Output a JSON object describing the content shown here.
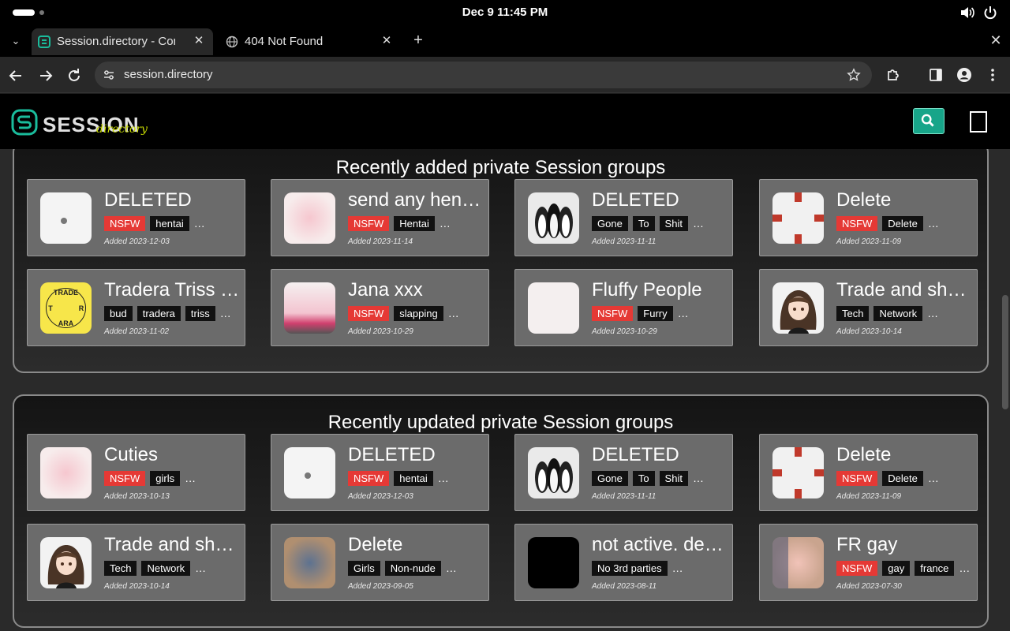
{
  "os": {
    "clock": "Dec 9  11:45 PM"
  },
  "browser": {
    "tabs": [
      {
        "title": "Session.directory - Conn",
        "favicon": "session-favicon"
      },
      {
        "title": "404 Not Found",
        "favicon": "globe-icon"
      }
    ],
    "url": "session.directory"
  },
  "site": {
    "logo_text": "SESSION",
    "logo_sub": "directory",
    "accent": "#17a589"
  },
  "sections": [
    {
      "heading": "Recently added private Session groups",
      "cards": [
        {
          "title": "DELETED",
          "tags": [
            {
              "label": "NSFW",
              "nsfw": true
            },
            {
              "label": "hentai"
            }
          ],
          "added": "Added 2023-12-03",
          "thumb": "white-dot"
        },
        {
          "title": "send any hen…",
          "tags": [
            {
              "label": "NSFW",
              "nsfw": true
            },
            {
              "label": "Hentai"
            }
          ],
          "added": "Added 2023-11-14",
          "thumb": "pink-blur"
        },
        {
          "title": "DELETED",
          "tags": [
            {
              "label": "Gone"
            },
            {
              "label": "To"
            },
            {
              "label": "Shit"
            }
          ],
          "added": "Added 2023-11-11",
          "thumb": "penguins"
        },
        {
          "title": "Delete",
          "tags": [
            {
              "label": "NSFW",
              "nsfw": true
            },
            {
              "label": "Delete"
            }
          ],
          "added": "Added 2023-11-09",
          "thumb": "red-cross"
        },
        {
          "title": "Tradera Triss …",
          "tags": [
            {
              "label": "bud"
            },
            {
              "label": "tradera"
            },
            {
              "label": "triss"
            }
          ],
          "added": "Added 2023-11-02",
          "thumb": "tradera-logo"
        },
        {
          "title": "Jana xxx",
          "tags": [
            {
              "label": "NSFW",
              "nsfw": true
            },
            {
              "label": "slapping"
            }
          ],
          "added": "Added 2023-10-29",
          "thumb": "pink-band"
        },
        {
          "title": "Fluffy People",
          "tags": [
            {
              "label": "NSFW",
              "nsfw": true
            },
            {
              "label": "Furry"
            }
          ],
          "added": "Added 2023-10-29",
          "thumb": "white-blank"
        },
        {
          "title": "Trade and sh…",
          "tags": [
            {
              "label": "Tech"
            },
            {
              "label": "Network"
            }
          ],
          "added": "Added 2023-10-14",
          "thumb": "anime-girl"
        }
      ]
    },
    {
      "heading": "Recently updated private Session groups",
      "cards": [
        {
          "title": "Cuties",
          "tags": [
            {
              "label": "NSFW",
              "nsfw": true
            },
            {
              "label": "girls"
            }
          ],
          "added": "Added 2023-10-13",
          "thumb": "pink-blur"
        },
        {
          "title": "DELETED",
          "tags": [
            {
              "label": "NSFW",
              "nsfw": true
            },
            {
              "label": "hentai"
            }
          ],
          "added": "Added 2023-12-03",
          "thumb": "white-dot"
        },
        {
          "title": "DELETED",
          "tags": [
            {
              "label": "Gone"
            },
            {
              "label": "To"
            },
            {
              "label": "Shit"
            }
          ],
          "added": "Added 2023-11-11",
          "thumb": "penguins"
        },
        {
          "title": "Delete",
          "tags": [
            {
              "label": "NSFW",
              "nsfw": true
            },
            {
              "label": "Delete"
            }
          ],
          "added": "Added 2023-11-09",
          "thumb": "red-cross"
        },
        {
          "title": "Trade and sh…",
          "tags": [
            {
              "label": "Tech"
            },
            {
              "label": "Network"
            }
          ],
          "added": "Added 2023-10-14",
          "thumb": "anime-girl"
        },
        {
          "title": "Delete",
          "tags": [
            {
              "label": "Girls"
            },
            {
              "label": "Non-nude"
            }
          ],
          "added": "Added 2023-09-05",
          "thumb": "denim"
        },
        {
          "title": "not active. del…",
          "tags": [
            {
              "label": "No 3rd parties"
            }
          ],
          "added": "Added 2023-08-11",
          "thumb": "black"
        },
        {
          "title": "FR gay",
          "tags": [
            {
              "label": "NSFW",
              "nsfw": true
            },
            {
              "label": "gay"
            },
            {
              "label": "france"
            }
          ],
          "added": "Added 2023-07-30",
          "thumb": "skin-blur"
        }
      ]
    }
  ],
  "more_glyph": "…",
  "tab_menu_glyph": "⌄",
  "close_glyph": "✕",
  "newtab_glyph": "+"
}
